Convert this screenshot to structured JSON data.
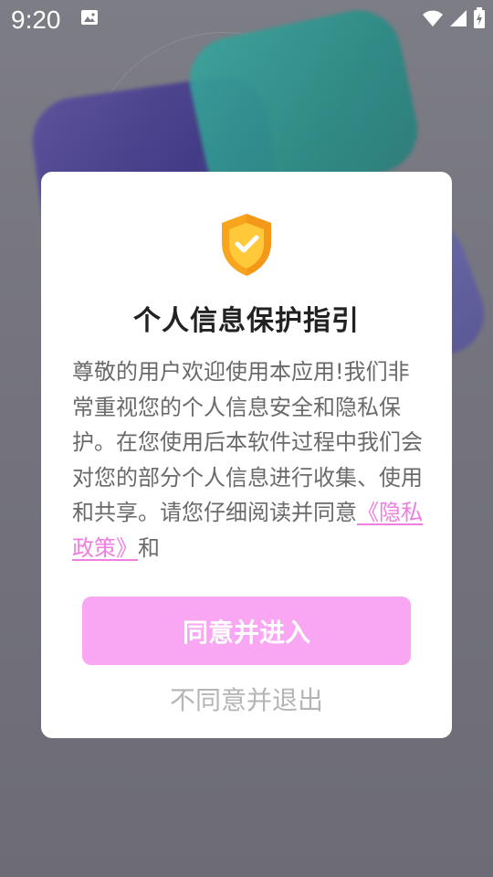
{
  "status_bar": {
    "time": "9:20",
    "icons": [
      "photo-icon",
      "wifi-icon",
      "signal-icon",
      "battery-icon"
    ]
  },
  "dialog": {
    "icon": "shield-check-icon",
    "title": "个人信息保护指引",
    "body_text": "尊敬的用户欢迎使用本应用!我们非常重视您的个人信息安全和隐私保护。在您使用后本软件过程中我们会对您的部分个人信息进行收集、使用和共享。请您仔细阅读并同意",
    "privacy_link": "《隐私政策》",
    "body_suffix": "和",
    "agree_label": "同意并进入",
    "disagree_label": "不同意并退出"
  },
  "colors": {
    "accent": "#f9a6f3",
    "link": "#f07de0",
    "shield": "#f7a51c"
  }
}
